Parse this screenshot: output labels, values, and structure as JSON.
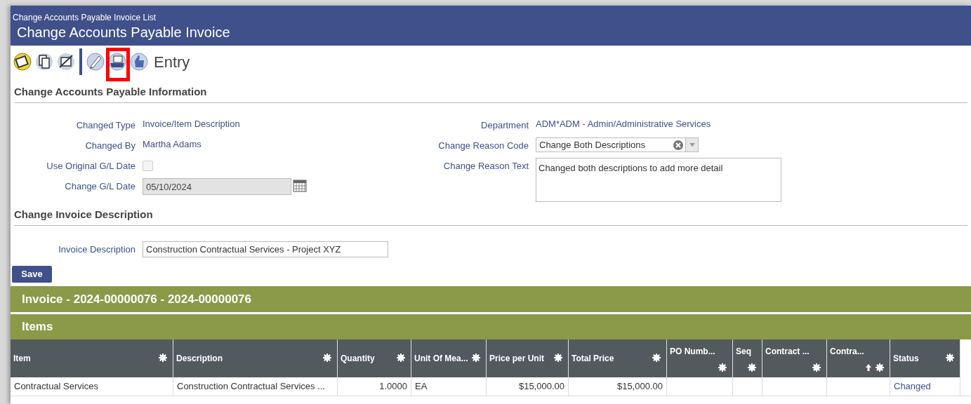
{
  "breadcrumb": "Change Accounts Payable Invoice List",
  "title": "Change Accounts Payable Invoice",
  "toolbar": {
    "icons": [
      {
        "kind": "notepad",
        "highlighted": false
      },
      {
        "kind": "copy",
        "highlighted": false
      },
      {
        "kind": "void",
        "highlighted": false
      },
      {
        "kind": "separator",
        "highlighted": false
      },
      {
        "kind": "check",
        "highlighted": false
      },
      {
        "kind": "printer",
        "highlighted": true
      },
      {
        "kind": "thumb",
        "highlighted": false
      }
    ],
    "label": "Entry"
  },
  "info_section": {
    "title": "Change Accounts Payable Information",
    "left_fields": [
      {
        "kind": "text",
        "label": "Changed Type",
        "value": "Invoice/Item Description"
      },
      {
        "kind": "text",
        "label": "Changed By",
        "value": "Martha Adams"
      },
      {
        "kind": "checkbox",
        "label": "Use Original G/L Date",
        "checked": false
      },
      {
        "kind": "date",
        "label": "Change G/L Date",
        "value": "05/10/2024",
        "disabled": true
      }
    ],
    "right_fields": [
      {
        "kind": "text",
        "label": "Department",
        "value": "ADM*ADM - Admin/Administrative Services"
      },
      {
        "kind": "select",
        "label": "Change Reason Code",
        "value": "Change Both Descriptions"
      },
      {
        "kind": "textarea",
        "label": "Change Reason Text",
        "value": "Changed both descriptions to add more detail"
      }
    ]
  },
  "description_section": {
    "title": "Change Invoice Description",
    "label": "Invoice Description",
    "value": "Construction Contractual Services - Project XYZ"
  },
  "save_button": "Save",
  "invoice_bar": "Invoice - 2024-00000076 - 2024-00000076",
  "items_bar": "Items",
  "table": {
    "columns": [
      {
        "label": "Item",
        "sorted": false
      },
      {
        "label": "Description",
        "sorted": false
      },
      {
        "label": "Quantity",
        "sorted": false
      },
      {
        "label": "Unit Of Mea...",
        "sorted": false
      },
      {
        "label": "Price per Unit",
        "sorted": false
      },
      {
        "label": "Total Price",
        "sorted": false
      },
      {
        "label": "PO Numb...",
        "sorted": false
      },
      {
        "label": "Seq",
        "sorted": false
      },
      {
        "label": "Contract ...",
        "sorted": false
      },
      {
        "label": "Contra...",
        "sorted": true
      },
      {
        "label": "Status",
        "sorted": false
      }
    ],
    "rows": [
      [
        "Contractual Services",
        "Construction Contractual Services ...",
        "1.0000",
        "EA",
        "$15,000.00",
        "$15,000.00",
        "",
        "",
        "",
        "",
        "Changed"
      ]
    ]
  }
}
